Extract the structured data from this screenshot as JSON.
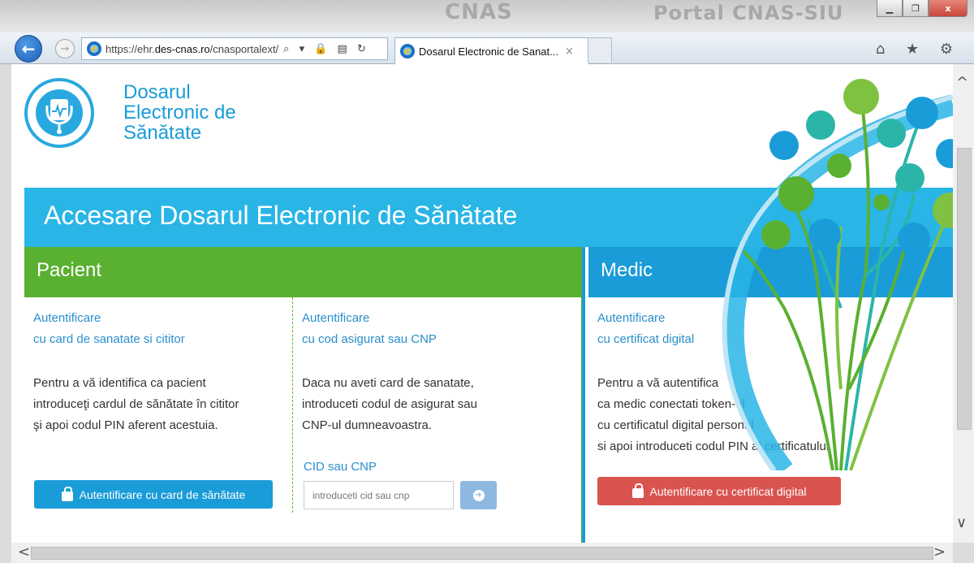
{
  "titlebar": {
    "background_text_1": "CNAS",
    "background_text_2": "Portal CNAS-SIU",
    "minimize_glyph": "▁",
    "restore_glyph": "❐",
    "close_glyph": "x"
  },
  "navbar": {
    "back_glyph": "←",
    "forward_glyph": "→",
    "url_prefix": "https://ehr.",
    "url_domain": "des-cnas.ro",
    "url_path": "/cnasportalext/",
    "addr_icons": "⌕ ▾ 🔒 ▤ ↻",
    "tab_title": "Dosarul Electronic de Sanat...",
    "tab_close": "×",
    "toolbar_icons": "⌂ ★ ⚙"
  },
  "logo": {
    "line1": "Dosarul",
    "line2": "Electronic de",
    "line3": "Sănătate"
  },
  "banner": {
    "title": "Accesare Dosarul Electronic de Sănătate"
  },
  "pacient": {
    "header": "Pacient",
    "card": {
      "link_line1": "Autentificare",
      "link_line2": "cu card de sanatate si cititor",
      "desc_line1": "Pentru a vă identifica ca pacient",
      "desc_line2": "introduceţi cardul de sănătate în cititor",
      "desc_line3": "şi apoi codul PIN aferent acestuia.",
      "button": "Autentificare cu card de sănătate"
    },
    "cnp": {
      "link_line1": "Autentificare",
      "link_line2": "cu cod asigurat sau CNP",
      "desc_line1": "Daca nu aveti card de sanatate,",
      "desc_line2": "introduceti codul de asigurat sau",
      "desc_line3": "CNP-ul dumneavoastra.",
      "field_label": "CID sau CNP",
      "placeholder": "introduceti cid sau cnp",
      "go_glyph": "➜"
    }
  },
  "medic": {
    "header": "Medic",
    "link_line1": "Autentificare",
    "link_line2": "cu certificat digital",
    "desc_line1": "Pentru a vă autentifica",
    "desc_line2": "ca medic conectati token-ul",
    "desc_line3": "cu certificatul digital personal",
    "desc_line4": "si apoi introduceti codul PIN al certificatului",
    "button": "Autentificare cu certificat digital"
  },
  "scrollbars": {
    "up": "^",
    "down": "∨",
    "left": "<",
    "right": ">"
  },
  "colors": {
    "brand_blue": "#29b5e6",
    "link_blue": "#2a8fcb",
    "pacient_green": "#5ab031",
    "medic_blue": "#1a9cd8",
    "card_button": "#1a9cd8",
    "cert_button": "#d9534f",
    "tree_green": "#5ab031",
    "tree_teal": "#2bb5a8"
  }
}
